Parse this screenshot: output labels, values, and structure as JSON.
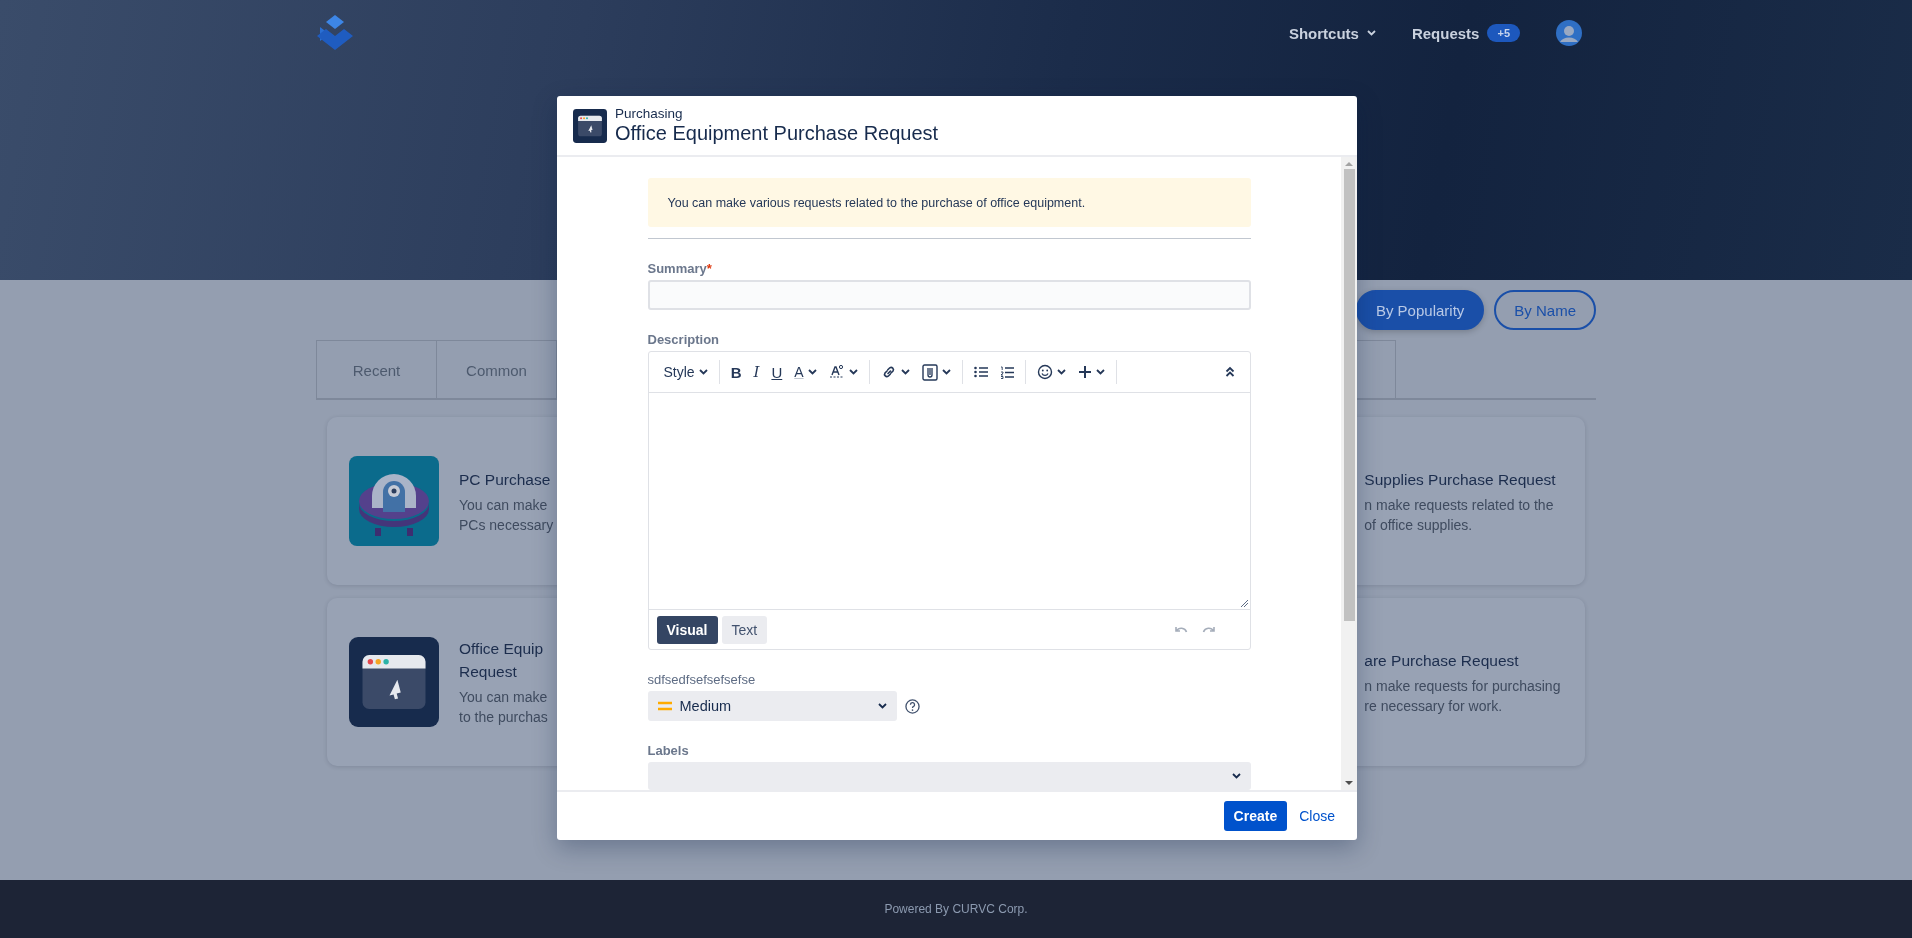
{
  "header": {
    "nav": [
      {
        "kind": "menu",
        "label": "Shortcuts"
      },
      {
        "kind": "counter",
        "label": "Requests",
        "badge": "+5"
      }
    ]
  },
  "sort_buttons": [
    {
      "label": "By Popularity",
      "selected": true
    },
    {
      "label": "By Name",
      "selected": false
    }
  ],
  "tabs": [
    {
      "label": "Recent",
      "selected": false
    },
    {
      "label": "Common",
      "selected": false
    }
  ],
  "cards_left": [
    {
      "kind": "pc",
      "title_lines": [
        "PC Purchase"
      ],
      "text_lines": [
        "You can make",
        "PCs necessary"
      ]
    },
    {
      "kind": "window",
      "title_lines": [
        "Office Equip",
        "Request"
      ],
      "text_lines": [
        "You can make",
        "to the purchas"
      ]
    }
  ],
  "cards_right": [
    {
      "title_lines": [
        "Supplies Purchase Request"
      ],
      "text_lines": [
        "n make requests related to the",
        "of office supplies."
      ]
    },
    {
      "title_lines": [
        "are Purchase Request"
      ],
      "text_lines": [
        "n make requests for purchasing",
        "re necessary for work."
      ]
    }
  ],
  "modal": {
    "category": "Purchasing",
    "title": "Office Equipment Purchase Request",
    "notice": "You can make various requests related to the purchase of office equipment.",
    "fields": [
      {
        "kind": "text",
        "label": "Summary",
        "required_mark": "*"
      },
      {
        "kind": "editor",
        "label": "Description",
        "toolbar": [
          [
            {
              "kind": "style",
              "label": "Style",
              "menu": true
            }
          ],
          [
            {
              "kind": "bold",
              "label": "B"
            },
            {
              "kind": "italic",
              "label": "I"
            },
            {
              "kind": "underline",
              "label": "U"
            },
            {
              "kind": "color",
              "label": "A",
              "menu": true
            },
            {
              "kind": "clear",
              "menu": true
            }
          ],
          [
            {
              "kind": "link",
              "menu": true
            },
            {
              "kind": "attach",
              "menu": true
            }
          ],
          [
            {
              "kind": "bullets"
            },
            {
              "kind": "numbers"
            }
          ],
          [
            {
              "kind": "emoji",
              "menu": true
            },
            {
              "kind": "insert",
              "menu": true
            }
          ]
        ],
        "toolbar_end": [
          {
            "kind": "collapse"
          }
        ],
        "modes": [
          {
            "label": "Visual",
            "selected": true
          },
          {
            "label": "Text",
            "selected": false
          }
        ],
        "history": [
          {
            "kind": "undo",
            "disabled": true
          },
          {
            "kind": "redo",
            "disabled": true
          }
        ]
      },
      {
        "kind": "select",
        "label": "sdfsedfsefsefsefse",
        "value": "Medium",
        "help": true
      },
      {
        "kind": "select",
        "label": "Labels",
        "wide": true
      }
    ],
    "buttons": [
      {
        "kind": "primary",
        "label": "Create"
      },
      {
        "kind": "link",
        "label": "Close"
      }
    ]
  },
  "footer": {
    "text": "Powered By CURVC Corp."
  }
}
